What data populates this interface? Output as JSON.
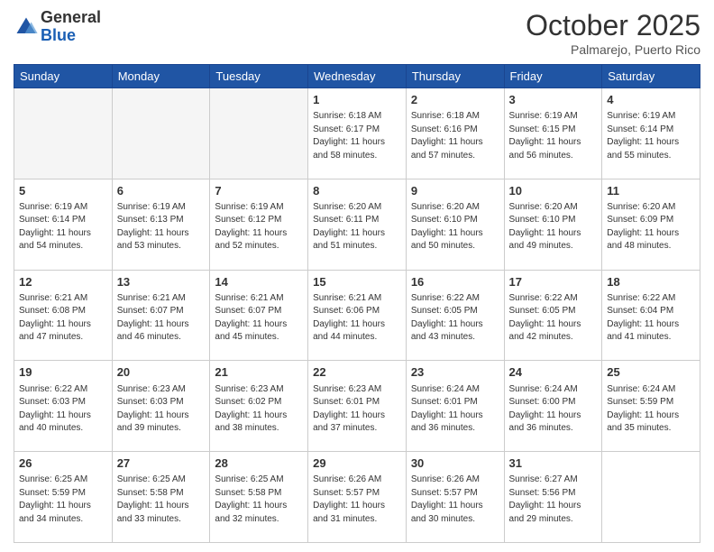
{
  "header": {
    "logo_general": "General",
    "logo_blue": "Blue",
    "month_title": "October 2025",
    "subtitle": "Palmarejo, Puerto Rico"
  },
  "calendar": {
    "days_of_week": [
      "Sunday",
      "Monday",
      "Tuesday",
      "Wednesday",
      "Thursday",
      "Friday",
      "Saturday"
    ],
    "weeks": [
      [
        {
          "day": "",
          "info": ""
        },
        {
          "day": "",
          "info": ""
        },
        {
          "day": "",
          "info": ""
        },
        {
          "day": "1",
          "info": "Sunrise: 6:18 AM\nSunset: 6:17 PM\nDaylight: 11 hours\nand 58 minutes."
        },
        {
          "day": "2",
          "info": "Sunrise: 6:18 AM\nSunset: 6:16 PM\nDaylight: 11 hours\nand 57 minutes."
        },
        {
          "day": "3",
          "info": "Sunrise: 6:19 AM\nSunset: 6:15 PM\nDaylight: 11 hours\nand 56 minutes."
        },
        {
          "day": "4",
          "info": "Sunrise: 6:19 AM\nSunset: 6:14 PM\nDaylight: 11 hours\nand 55 minutes."
        }
      ],
      [
        {
          "day": "5",
          "info": "Sunrise: 6:19 AM\nSunset: 6:14 PM\nDaylight: 11 hours\nand 54 minutes."
        },
        {
          "day": "6",
          "info": "Sunrise: 6:19 AM\nSunset: 6:13 PM\nDaylight: 11 hours\nand 53 minutes."
        },
        {
          "day": "7",
          "info": "Sunrise: 6:19 AM\nSunset: 6:12 PM\nDaylight: 11 hours\nand 52 minutes."
        },
        {
          "day": "8",
          "info": "Sunrise: 6:20 AM\nSunset: 6:11 PM\nDaylight: 11 hours\nand 51 minutes."
        },
        {
          "day": "9",
          "info": "Sunrise: 6:20 AM\nSunset: 6:10 PM\nDaylight: 11 hours\nand 50 minutes."
        },
        {
          "day": "10",
          "info": "Sunrise: 6:20 AM\nSunset: 6:10 PM\nDaylight: 11 hours\nand 49 minutes."
        },
        {
          "day": "11",
          "info": "Sunrise: 6:20 AM\nSunset: 6:09 PM\nDaylight: 11 hours\nand 48 minutes."
        }
      ],
      [
        {
          "day": "12",
          "info": "Sunrise: 6:21 AM\nSunset: 6:08 PM\nDaylight: 11 hours\nand 47 minutes."
        },
        {
          "day": "13",
          "info": "Sunrise: 6:21 AM\nSunset: 6:07 PM\nDaylight: 11 hours\nand 46 minutes."
        },
        {
          "day": "14",
          "info": "Sunrise: 6:21 AM\nSunset: 6:07 PM\nDaylight: 11 hours\nand 45 minutes."
        },
        {
          "day": "15",
          "info": "Sunrise: 6:21 AM\nSunset: 6:06 PM\nDaylight: 11 hours\nand 44 minutes."
        },
        {
          "day": "16",
          "info": "Sunrise: 6:22 AM\nSunset: 6:05 PM\nDaylight: 11 hours\nand 43 minutes."
        },
        {
          "day": "17",
          "info": "Sunrise: 6:22 AM\nSunset: 6:05 PM\nDaylight: 11 hours\nand 42 minutes."
        },
        {
          "day": "18",
          "info": "Sunrise: 6:22 AM\nSunset: 6:04 PM\nDaylight: 11 hours\nand 41 minutes."
        }
      ],
      [
        {
          "day": "19",
          "info": "Sunrise: 6:22 AM\nSunset: 6:03 PM\nDaylight: 11 hours\nand 40 minutes."
        },
        {
          "day": "20",
          "info": "Sunrise: 6:23 AM\nSunset: 6:03 PM\nDaylight: 11 hours\nand 39 minutes."
        },
        {
          "day": "21",
          "info": "Sunrise: 6:23 AM\nSunset: 6:02 PM\nDaylight: 11 hours\nand 38 minutes."
        },
        {
          "day": "22",
          "info": "Sunrise: 6:23 AM\nSunset: 6:01 PM\nDaylight: 11 hours\nand 37 minutes."
        },
        {
          "day": "23",
          "info": "Sunrise: 6:24 AM\nSunset: 6:01 PM\nDaylight: 11 hours\nand 36 minutes."
        },
        {
          "day": "24",
          "info": "Sunrise: 6:24 AM\nSunset: 6:00 PM\nDaylight: 11 hours\nand 36 minutes."
        },
        {
          "day": "25",
          "info": "Sunrise: 6:24 AM\nSunset: 5:59 PM\nDaylight: 11 hours\nand 35 minutes."
        }
      ],
      [
        {
          "day": "26",
          "info": "Sunrise: 6:25 AM\nSunset: 5:59 PM\nDaylight: 11 hours\nand 34 minutes."
        },
        {
          "day": "27",
          "info": "Sunrise: 6:25 AM\nSunset: 5:58 PM\nDaylight: 11 hours\nand 33 minutes."
        },
        {
          "day": "28",
          "info": "Sunrise: 6:25 AM\nSunset: 5:58 PM\nDaylight: 11 hours\nand 32 minutes."
        },
        {
          "day": "29",
          "info": "Sunrise: 6:26 AM\nSunset: 5:57 PM\nDaylight: 11 hours\nand 31 minutes."
        },
        {
          "day": "30",
          "info": "Sunrise: 6:26 AM\nSunset: 5:57 PM\nDaylight: 11 hours\nand 30 minutes."
        },
        {
          "day": "31",
          "info": "Sunrise: 6:27 AM\nSunset: 5:56 PM\nDaylight: 11 hours\nand 29 minutes."
        },
        {
          "day": "",
          "info": ""
        }
      ]
    ]
  }
}
